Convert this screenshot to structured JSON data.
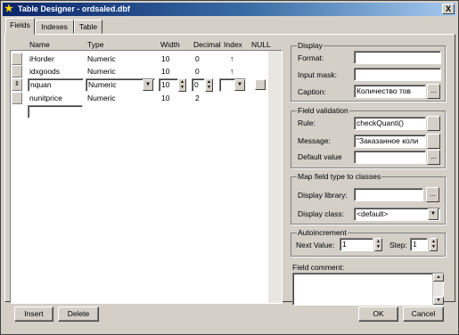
{
  "window": {
    "title": "Table Designer - ordsaled.dbf",
    "close": "X"
  },
  "tabs": [
    {
      "label": "Fields"
    },
    {
      "label": "Indexes"
    },
    {
      "label": "Table"
    }
  ],
  "columns": {
    "name": "Name",
    "type": "Type",
    "width": "Width",
    "decimal": "Decimal",
    "index": "Index",
    "null": "NULL"
  },
  "rows": [
    {
      "name": "iHorder",
      "type": "Numeric",
      "width": "10",
      "decimal": "0",
      "index": "↑"
    },
    {
      "name": "idxgoods",
      "type": "Numeric",
      "width": "10",
      "decimal": "0",
      "index": "↑"
    },
    {
      "name": "nquan",
      "type": "Numeric",
      "width": "10",
      "decimal": "0",
      "index": ""
    },
    {
      "name": "nunitprice",
      "type": "Numeric",
      "width": "10",
      "decimal": "2",
      "index": ""
    }
  ],
  "display": {
    "title": "Display",
    "format_label": "Format:",
    "format_value": "",
    "inputmask_label": "Input mask:",
    "inputmask_value": "",
    "caption_label": "Caption:",
    "caption_value": "Количество тов"
  },
  "field_validation": {
    "title": "Field validation",
    "rule_label": "Rule:",
    "rule_value": "checkQuanti()",
    "message_label": "Message:",
    "message_value": "\"Заказанное коли",
    "default_label": "Default value",
    "default_value": ""
  },
  "map_field": {
    "title": "Map field type to classes",
    "library_label": "Display library:",
    "library_value": "",
    "class_label": "Display class:",
    "class_value": "<default>"
  },
  "autoincrement": {
    "title": "Autoincrement",
    "next_label": "Next Value:",
    "next_value": "1",
    "step_label": "Step:",
    "step_value": "1"
  },
  "field_comment": {
    "label": "Field comment:",
    "value": ""
  },
  "buttons": {
    "insert": "Insert",
    "delete": "Delete",
    "ok": "OK",
    "cancel": "Cancel",
    "ellipsis": "..."
  },
  "icons": {
    "title": "wizard-star-icon"
  }
}
